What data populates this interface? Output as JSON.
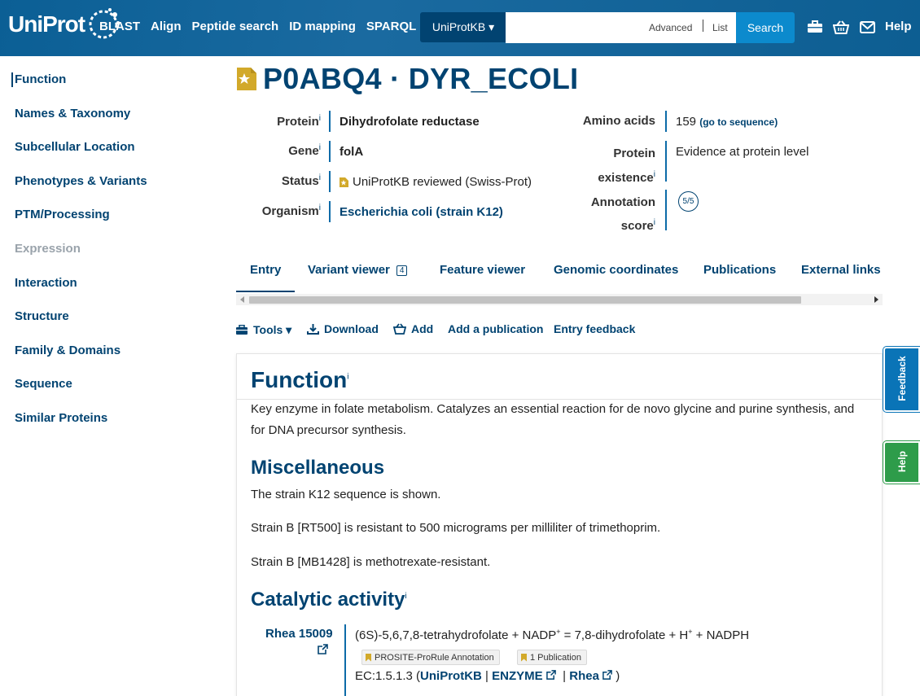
{
  "colors": {
    "brand": "#00639a",
    "link": "#014371",
    "accent": "#0c8acd",
    "feedback": "#0a74b7",
    "help": "#2e9c4a",
    "evidence_gold": "#d2a92a"
  },
  "header": {
    "logo_text": "UniProt",
    "nav": [
      "BLAST",
      "Align",
      "Peptide search",
      "ID mapping",
      "SPARQL"
    ],
    "db_select": "UniProtKB ▾",
    "search": {
      "value": "",
      "placeholder": "",
      "advanced": "Advanced",
      "list": "List",
      "button": "Search"
    },
    "icons": [
      "toolbox-icon",
      "basket-icon",
      "envelope-icon"
    ],
    "help": "Help"
  },
  "sidebar": {
    "items": [
      {
        "label": "Function",
        "active": true
      },
      {
        "label": "Names & Taxonomy"
      },
      {
        "label": "Subcellular Location"
      },
      {
        "label": "Phenotypes & Variants"
      },
      {
        "label": "PTM/Processing"
      },
      {
        "label": "Expression",
        "disabled": true
      },
      {
        "label": "Interaction"
      },
      {
        "label": "Structure"
      },
      {
        "label": "Family & Domains"
      },
      {
        "label": "Sequence"
      },
      {
        "label": "Similar Proteins"
      }
    ]
  },
  "entry": {
    "title": "P0ABQ4 · DYR_ECOLI",
    "labels": {
      "protein": "Protein",
      "gene": "Gene",
      "status": "Status",
      "organism": "Organism",
      "info": "i",
      "amino_acids": "Amino acids",
      "protein_existence_1": "Protein",
      "protein_existence_2": "existence",
      "annotation_score_1": "Annotation",
      "annotation_score_2": "score"
    },
    "protein": "Dihydrofolate reductase",
    "gene": "folA",
    "status": "UniProtKB reviewed (Swiss-Prot)",
    "organism": "Escherichia coli (strain K12)",
    "amino_acids": "159",
    "go_to_sequence": "(go to sequence)",
    "protein_existence": "Evidence at protein level",
    "annotation_score": "5/5"
  },
  "tabs": [
    {
      "label": "Entry",
      "active": true
    },
    {
      "label": "Variant viewer",
      "badge": "4"
    },
    {
      "label": "Feature viewer"
    },
    {
      "label": "Genomic coordinates"
    },
    {
      "label": "Publications"
    },
    {
      "label": "External links"
    }
  ],
  "toolbar": {
    "tools": "Tools ▾",
    "download": "Download",
    "add": "Add",
    "add_publication": "Add a publication",
    "entry_feedback": "Entry feedback"
  },
  "function": {
    "heading": "Function",
    "description": "Key enzyme in folate metabolism. Catalyzes an essential reaction for de novo glycine and purine synthesis, and for DNA precursor synthesis.",
    "misc_heading": "Miscellaneous",
    "misc": [
      "The strain K12 sequence is shown.",
      "Strain B [RT500] is resistant to 500 micrograms per milliliter of trimethoprim.",
      "Strain B [MB1428] is methotrexate-resistant."
    ],
    "catalytic_heading": "Catalytic activity",
    "rhea": "Rhea 15009",
    "reaction_a": "(6S)-5,6,7,8-tetrahydrofolate + NADP",
    "reaction_b": " = 7,8-dihydrofolate + H",
    "reaction_c": " + NADPH",
    "sup_plus": "+",
    "evidence": [
      "PROSITE-ProRule Annotation",
      "1 Publication"
    ],
    "ec_prefix": "EC:1.5.1.3 (",
    "ec_links": [
      "UniProtKB",
      "ENZYME",
      "Rhea"
    ],
    "ec_sep": "|",
    "ec_suffix": ")"
  },
  "floating": {
    "feedback": "Feedback",
    "help": "Help"
  }
}
